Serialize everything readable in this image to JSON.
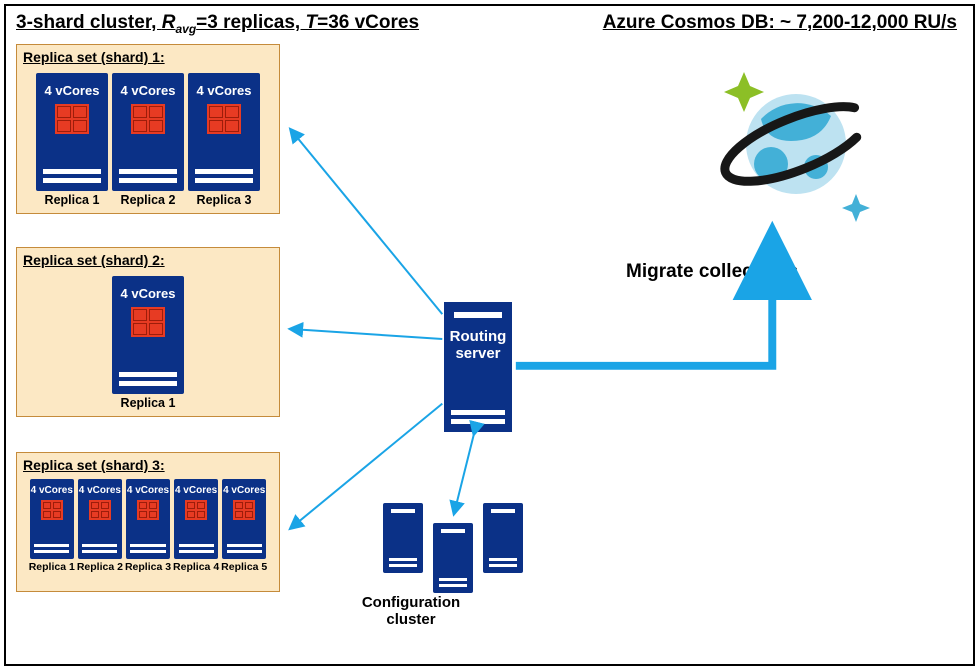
{
  "title_left_prefix": "3-shard cluster, ",
  "title_left_ravg_sym": "R",
  "title_left_ravg_sub": "avg",
  "title_left_mid": "=3 replicas, ",
  "title_left_tsym": "T",
  "title_left_suffix": "=36 vCores",
  "title_right": "Azure Cosmos DB: ~ 7,200-12,000 RU/s",
  "shards": [
    {
      "title": "Replica set (shard) 1:",
      "vcores": "4 vCores",
      "replicas": [
        "Replica 1",
        "Replica 2",
        "Replica 3"
      ]
    },
    {
      "title": "Replica set (shard) 2:",
      "vcores": "4 vCores",
      "replicas": [
        "Replica 1"
      ]
    },
    {
      "title": "Replica set (shard) 3:",
      "vcores": "4 vCores",
      "replicas": [
        "Replica 1",
        "Replica 2",
        "Replica 3",
        "Replica 4",
        "Replica 5"
      ]
    }
  ],
  "routing_label_l1": "Routing",
  "routing_label_l2": "server",
  "config_label_l1": "Configuration",
  "config_label_l2": "cluster",
  "migrate_label": "Migrate collections",
  "colors": {
    "panel_bg": "#fce8c4",
    "panel_border": "#c58b3b",
    "server_blue": "#0b3187",
    "arrow_blue": "#1aa4e6",
    "accent_red": "#e73b23",
    "spark_green": "#8cbf26",
    "planet_light": "#bde2f1",
    "planet_dark": "#43b0d7",
    "ring": "#171717"
  }
}
